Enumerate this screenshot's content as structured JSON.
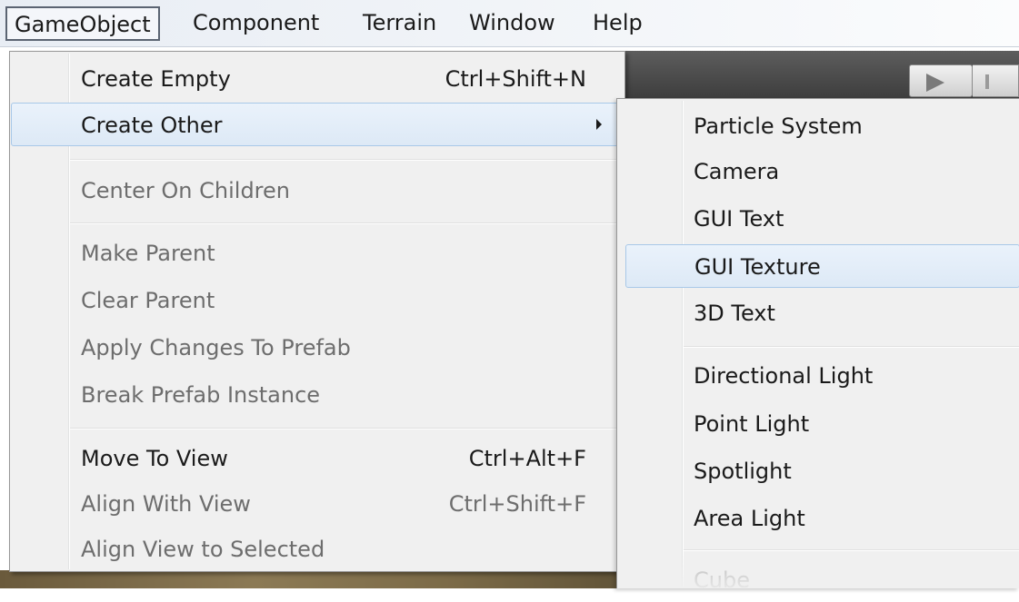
{
  "menubar": {
    "items": [
      "GameObject",
      "Component",
      "Terrain",
      "Window",
      "Help"
    ]
  },
  "main_menu": {
    "create_empty": {
      "label": "Create Empty",
      "shortcut": "Ctrl+Shift+N"
    },
    "create_other": {
      "label": "Create Other"
    },
    "center_on_children": {
      "label": "Center On Children"
    },
    "make_parent": {
      "label": "Make Parent"
    },
    "clear_parent": {
      "label": "Clear Parent"
    },
    "apply_changes": {
      "label": "Apply Changes To Prefab"
    },
    "break_prefab": {
      "label": "Break Prefab Instance"
    },
    "move_to_view": {
      "label": "Move To View",
      "shortcut": "Ctrl+Alt+F"
    },
    "align_with_view": {
      "label": "Align With View",
      "shortcut": "Ctrl+Shift+F"
    },
    "align_view_to_selected": {
      "label": "Align View to Selected"
    }
  },
  "sub_menu": {
    "items": [
      "Particle System",
      "Camera",
      "GUI Text",
      "GUI Texture",
      "3D Text",
      "Directional Light",
      "Point Light",
      "Spotlight",
      "Area Light",
      "Cube"
    ]
  },
  "colors": {
    "hover_bg": "#dde9f6",
    "hover_border": "#a8c8e8",
    "disabled_text": "#6d6d6d",
    "menu_bg": "#f0f0f0"
  }
}
